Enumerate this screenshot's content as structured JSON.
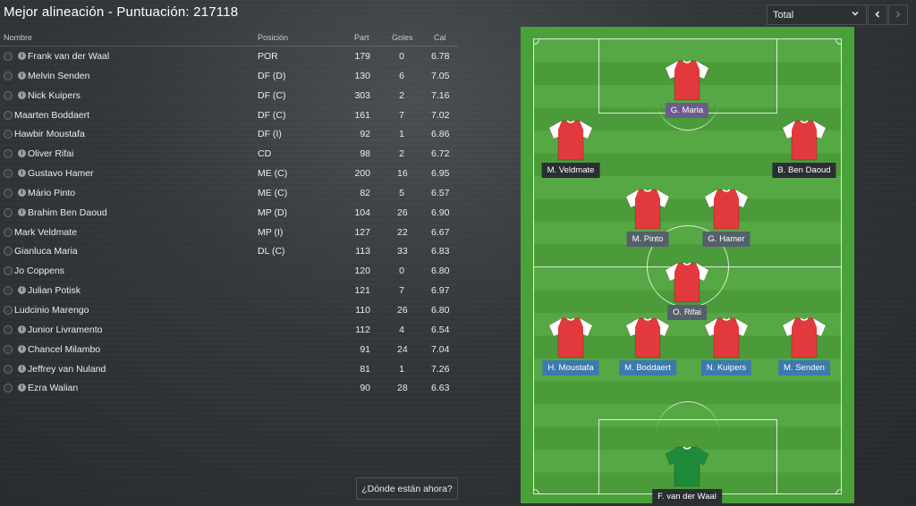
{
  "header": {
    "title": "Mejor alineación - Puntuación: 217118",
    "filter_value": "Total",
    "prev_label": "‹",
    "next_label": "›"
  },
  "table": {
    "columns": {
      "name": "Nombre",
      "position": "Posición",
      "apps": "Part",
      "goals": "Goles",
      "rating": "Cal"
    },
    "rows": [
      {
        "name": "Frank van der Waal",
        "info": true,
        "position": "POR",
        "apps": "179",
        "goals": "0",
        "rating": "6.78"
      },
      {
        "name": "Melvin Senden",
        "info": true,
        "position": "DF (D)",
        "apps": "130",
        "goals": "6",
        "rating": "7.05"
      },
      {
        "name": "Nick Kuipers",
        "info": true,
        "position": "DF (C)",
        "apps": "303",
        "goals": "2",
        "rating": "7.16"
      },
      {
        "name": "Maarten Boddaert",
        "info": false,
        "position": "DF (C)",
        "apps": "161",
        "goals": "7",
        "rating": "7.02"
      },
      {
        "name": "Hawbir Moustafa",
        "info": false,
        "position": "DF (I)",
        "apps": "92",
        "goals": "1",
        "rating": "6.86"
      },
      {
        "name": "Oliver Rifai",
        "info": true,
        "position": "CD",
        "apps": "98",
        "goals": "2",
        "rating": "6.72"
      },
      {
        "name": "Gustavo Hamer",
        "info": true,
        "position": "ME (C)",
        "apps": "200",
        "goals": "16",
        "rating": "6.95"
      },
      {
        "name": "Mário Pinto",
        "info": true,
        "position": "ME (C)",
        "apps": "82",
        "goals": "5",
        "rating": "6.57"
      },
      {
        "name": "Brahim Ben Daoud",
        "info": true,
        "position": "MP (D)",
        "apps": "104",
        "goals": "26",
        "rating": "6.90"
      },
      {
        "name": "Mark Veldmate",
        "info": false,
        "position": "MP (I)",
        "apps": "127",
        "goals": "22",
        "rating": "6.67"
      },
      {
        "name": "Gianluca Maria",
        "info": false,
        "position": "DL (C)",
        "apps": "113",
        "goals": "33",
        "rating": "6.83"
      },
      {
        "name": "Jo Coppens",
        "info": false,
        "position": "",
        "apps": "120",
        "goals": "0",
        "rating": "6.80"
      },
      {
        "name": "Julian Potisk",
        "info": true,
        "position": "",
        "apps": "121",
        "goals": "7",
        "rating": "6.97"
      },
      {
        "name": "Ludcinio Marengo",
        "info": false,
        "position": "",
        "apps": "110",
        "goals": "26",
        "rating": "6.80"
      },
      {
        "name": "Junior Livramento",
        "info": true,
        "position": "",
        "apps": "112",
        "goals": "4",
        "rating": "6.54"
      },
      {
        "name": "Chancel Milambo",
        "info": true,
        "position": "",
        "apps": "91",
        "goals": "24",
        "rating": "7.04"
      },
      {
        "name": "Jeffrey van Nuland",
        "info": true,
        "position": "",
        "apps": "81",
        "goals": "1",
        "rating": "7.26"
      },
      {
        "name": "Ezra Walian",
        "info": true,
        "position": "",
        "apps": "90",
        "goals": "28",
        "rating": "6.63"
      }
    ]
  },
  "where_button": "¿Dónde están ahora?",
  "pitch": {
    "players": {
      "st": "G. Maria",
      "lw": "M. Veldmate",
      "rw": "B. Ben Daoud",
      "cm1": "M. Pinto",
      "cm2": "G. Hamer",
      "dm": "O. Rifai",
      "lb": "H. Moustafa",
      "cb1": "M. Boddaert",
      "cb2": "N. Kuipers",
      "rb": "M. Senden",
      "gk": "F. van der Waal"
    }
  },
  "colors": {
    "pitch_green": "#4aa13a",
    "shirt_red": "#e23a3c",
    "keeper_green": "#1e8a3a",
    "label_defender": "#3e79ad",
    "label_midfield": "#55606b",
    "label_forward": "#6c5b8f",
    "label_wide": "#2b2f33"
  },
  "icons": [
    "chevron-down-icon",
    "chevron-left-icon",
    "chevron-right-icon",
    "info-icon",
    "status-circle-icon",
    "shirt-icon"
  ]
}
